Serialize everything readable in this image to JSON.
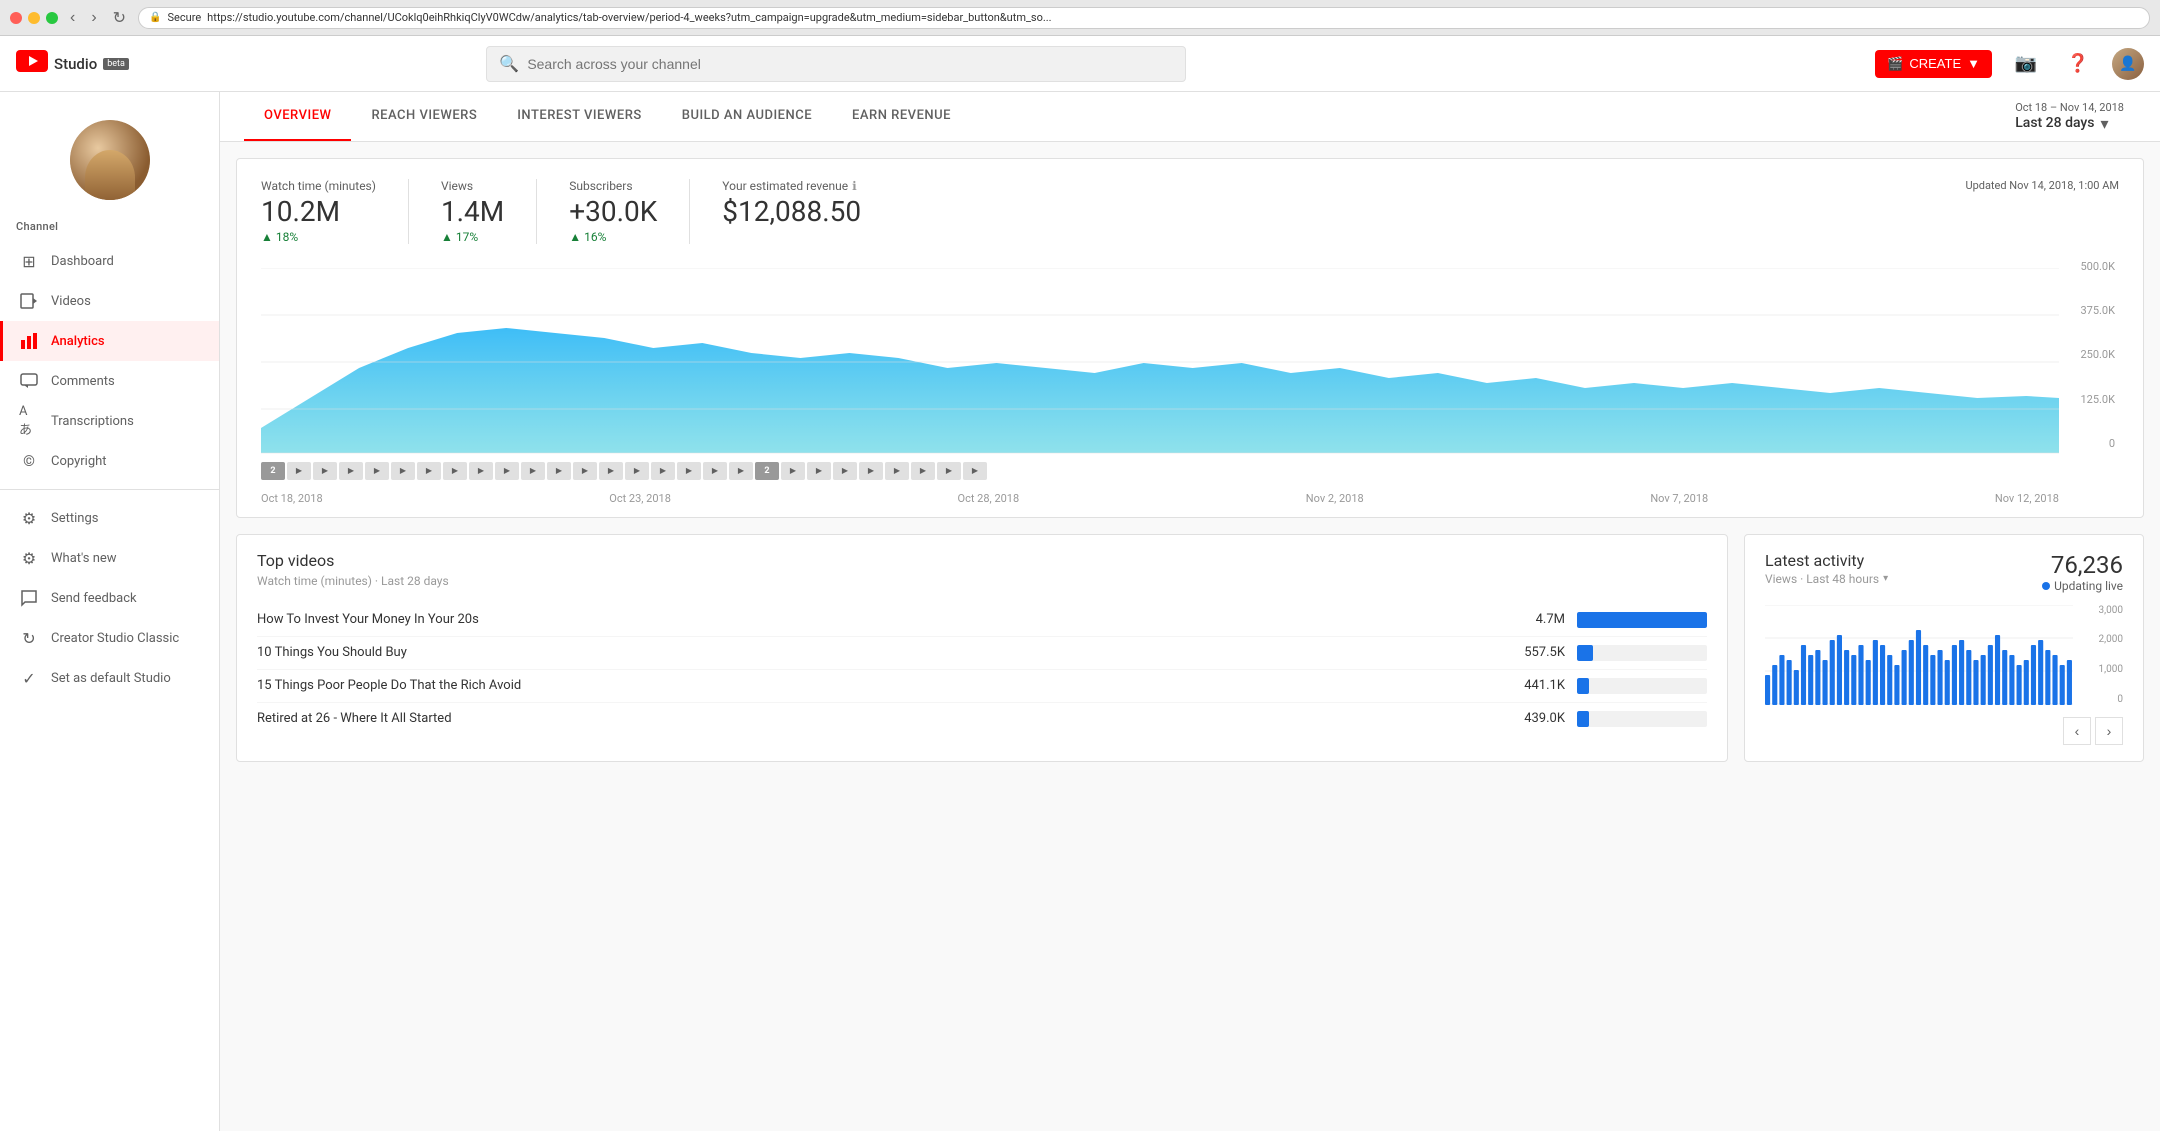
{
  "browser": {
    "url": "https://studio.youtube.com/channel/UCoklq0eihRhkiqClyV0WCdw/analytics/tab-overview/period-4_weeks?utm_campaign=upgrade&utm_medium=sidebar_button&utm_so...",
    "secure_label": "Secure"
  },
  "header": {
    "logo_text": "Studio",
    "beta_label": "beta",
    "search_placeholder": "Search across your channel",
    "create_label": "CREATE",
    "date_range_label": "Oct 18 – Nov 14, 2018",
    "date_range_value": "Last 28 days"
  },
  "sidebar": {
    "channel_label": "Channel",
    "items": [
      {
        "id": "dashboard",
        "label": "Dashboard",
        "icon": "⊞"
      },
      {
        "id": "videos",
        "label": "Videos",
        "icon": "▶"
      },
      {
        "id": "analytics",
        "label": "Analytics",
        "icon": "📊",
        "active": true
      },
      {
        "id": "comments",
        "label": "Comments",
        "icon": "💬"
      },
      {
        "id": "transcriptions",
        "label": "Transcriptions",
        "icon": "Aあ"
      },
      {
        "id": "copyright",
        "label": "Copyright",
        "icon": "©"
      }
    ],
    "bottom_items": [
      {
        "id": "settings",
        "label": "Settings",
        "icon": "⚙"
      },
      {
        "id": "whats-new",
        "label": "What's new",
        "icon": "⚙"
      },
      {
        "id": "send-feedback",
        "label": "Send feedback",
        "icon": "✉"
      },
      {
        "id": "creator-studio",
        "label": "Creator Studio Classic",
        "icon": "↻"
      },
      {
        "id": "set-default",
        "label": "Set as default Studio",
        "icon": "✓"
      }
    ]
  },
  "analytics": {
    "tabs": [
      {
        "id": "overview",
        "label": "OVERVIEW",
        "active": true
      },
      {
        "id": "reach-viewers",
        "label": "REACH VIEWERS"
      },
      {
        "id": "interest-viewers",
        "label": "INTEREST VIEWERS"
      },
      {
        "id": "build-audience",
        "label": "BUILD AN AUDIENCE"
      },
      {
        "id": "earn-revenue",
        "label": "EARN REVENUE"
      }
    ],
    "updated_text": "Updated Nov 14, 2018, 1:00 AM",
    "stats": [
      {
        "id": "watch-time",
        "label": "Watch time (minutes)",
        "value": "10.2M",
        "change": "18%",
        "show_info": false
      },
      {
        "id": "views",
        "label": "Views",
        "value": "1.4M",
        "change": "17%",
        "show_info": false
      },
      {
        "id": "subscribers",
        "label": "Subscribers",
        "value": "+30.0K",
        "change": "16%",
        "show_info": false
      },
      {
        "id": "revenue",
        "label": "Your estimated revenue",
        "value": "$12,088.50",
        "change": "",
        "show_info": true
      }
    ],
    "chart": {
      "y_labels": [
        "500.0K",
        "375.0K",
        "250.0K",
        "125.0K",
        "0"
      ],
      "x_labels": [
        "Oct 18, 2018",
        "Oct 23, 2018",
        "Oct 28, 2018",
        "Nov 2, 2018",
        "Nov 7, 2018",
        "Nov 12, 2018"
      ]
    }
  },
  "top_videos": {
    "title": "Top videos",
    "subtitle": "Watch time (minutes) · Last 28 days",
    "videos": [
      {
        "title": "How To Invest Your Money In Your 20s",
        "views": "4.7M",
        "bar_pct": 100
      },
      {
        "title": "10 Things You Should Buy",
        "views": "557.5K",
        "bar_pct": 12
      },
      {
        "title": "15 Things Poor People Do That the Rich Avoid",
        "views": "441.1K",
        "bar_pct": 9
      },
      {
        "title": "Retired at 26 - Where It All Started",
        "views": "439.0K",
        "bar_pct": 9
      }
    ]
  },
  "latest_activity": {
    "title": "Latest activity",
    "count": "76,236",
    "live_label": "Updating live",
    "views_label": "Views · Last 48 hours",
    "y_labels": [
      "3,000",
      "2,000",
      "1,000",
      "0"
    ]
  }
}
